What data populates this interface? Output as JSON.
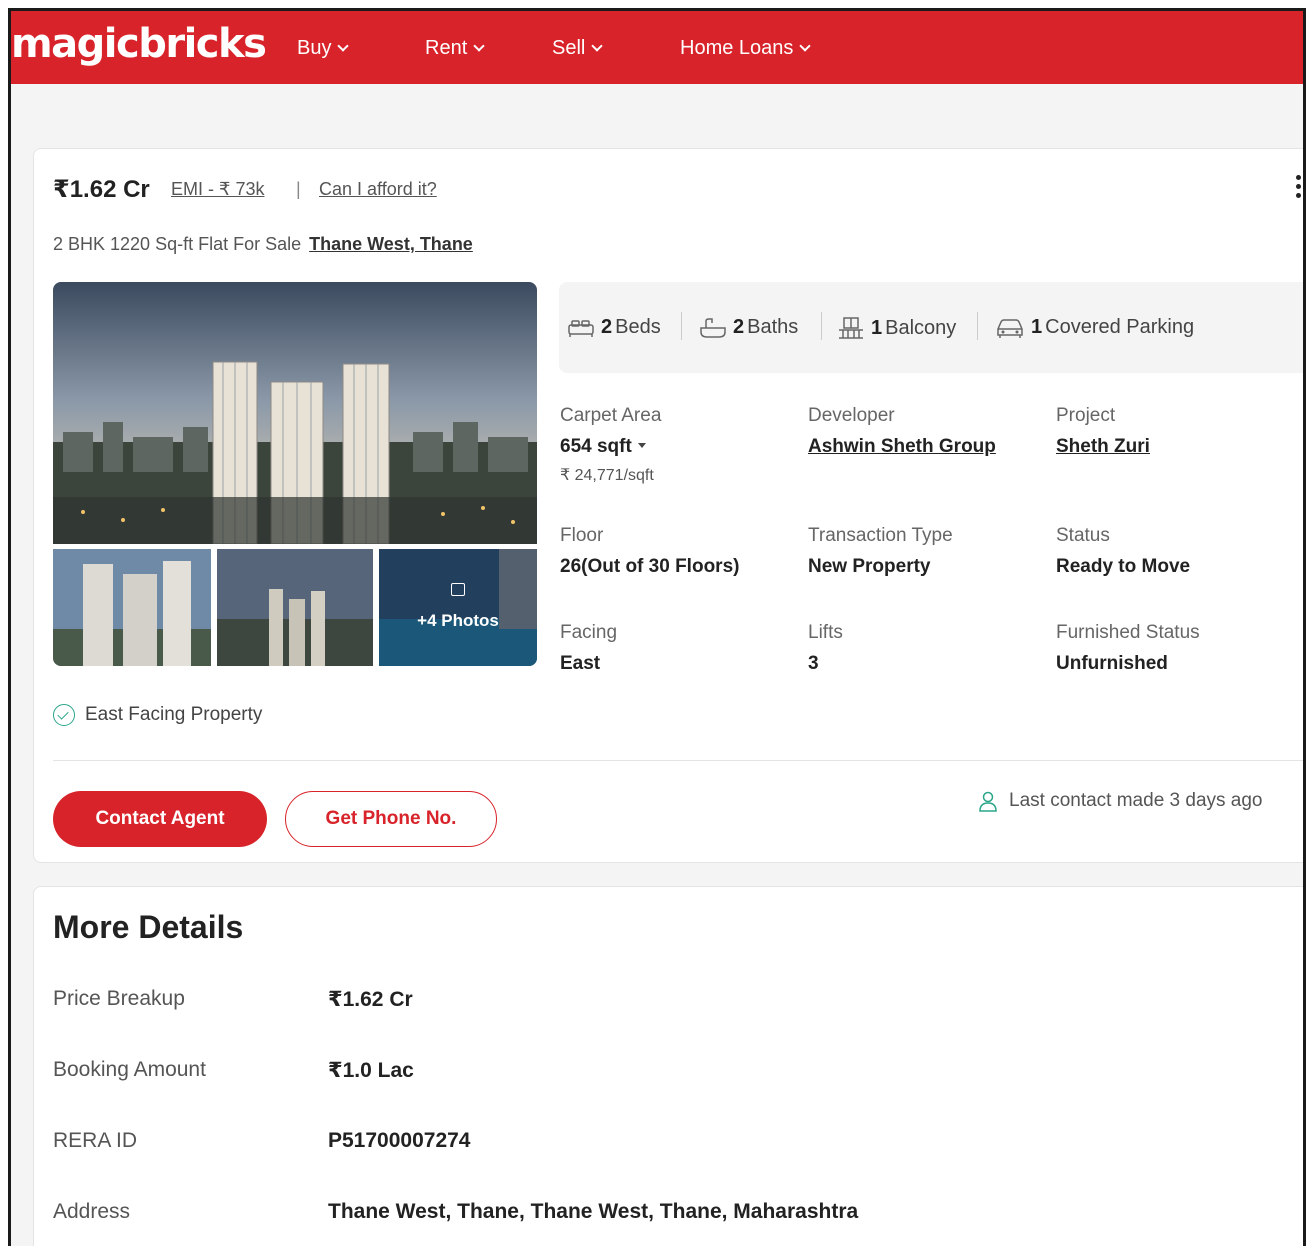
{
  "header": {
    "logo": "magicbricks",
    "nav": [
      "Buy",
      "Rent",
      "Sell",
      "Home Loans"
    ]
  },
  "listing": {
    "price": "₹1.62 Cr",
    "emi": "EMI - ₹ 73k",
    "separator": "|",
    "afford": "Can I afford it?",
    "title": "2 BHK 1220 Sq-ft Flat For Sale",
    "location": "Thane West, Thane",
    "more_photos": "+4 Photos",
    "amenities": [
      {
        "count": "2",
        "label": "Beds",
        "icon": "bed-icon"
      },
      {
        "count": "2",
        "label": "Baths",
        "icon": "bath-icon"
      },
      {
        "count": "1",
        "label": "Balcony",
        "icon": "balcony-icon"
      },
      {
        "count": "1",
        "label": "Covered Parking",
        "icon": "car-icon"
      }
    ],
    "details": {
      "carpet_area": {
        "label": "Carpet Area",
        "value": "654 sqft",
        "per_sqft": "₹ 24,771/sqft"
      },
      "developer": {
        "label": "Developer",
        "value": "Ashwin Sheth Group"
      },
      "project": {
        "label": "Project",
        "value": "Sheth Zuri"
      },
      "floor": {
        "label": "Floor",
        "value": "26(Out of 30 Floors)"
      },
      "transaction": {
        "label": "Transaction Type",
        "value": "New Property"
      },
      "status": {
        "label": "Status",
        "value": "Ready to Move"
      },
      "facing": {
        "label": "Facing",
        "value": "East"
      },
      "lifts": {
        "label": "Lifts",
        "value": "3"
      },
      "furnished": {
        "label": "Furnished Status",
        "value": "Unfurnished"
      }
    },
    "feature_tag": "East Facing Property",
    "contact_button": "Contact Agent",
    "phone_button": "Get Phone No.",
    "last_contact": "Last contact made 3 days ago"
  },
  "more_details": {
    "title": "More Details",
    "rows": [
      {
        "label": "Price Breakup",
        "value": "₹1.62 Cr"
      },
      {
        "label": "Booking Amount",
        "value": "₹1.0 Lac"
      },
      {
        "label": "RERA ID",
        "value": "P51700007274"
      },
      {
        "label": "Address",
        "value": "Thane West, Thane, Thane West, Thane, Maharashtra"
      }
    ]
  },
  "colors": {
    "brand": "#d8232a",
    "check": "#2aa58a"
  }
}
